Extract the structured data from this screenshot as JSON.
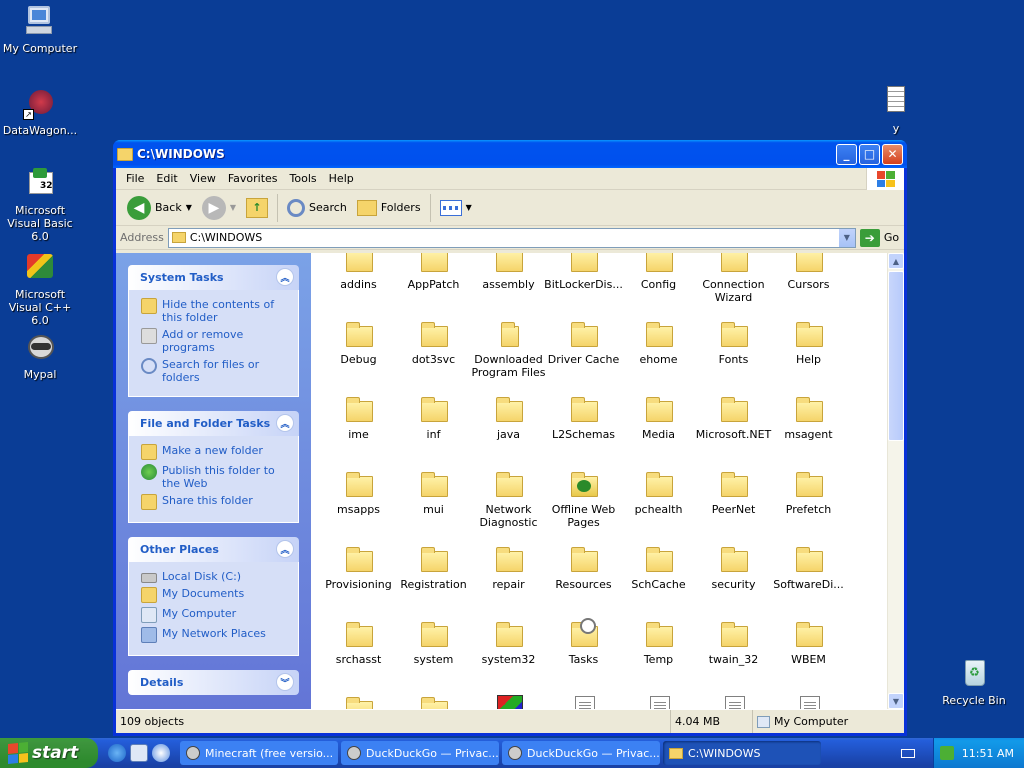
{
  "desktop": {
    "icons": [
      {
        "label": "My Computer"
      },
      {
        "label": "DataWagon..."
      },
      {
        "label": "Microsoft Visual Basic 6.0"
      },
      {
        "label": "Microsoft Visual C++ 6.0"
      },
      {
        "label": "Mypal"
      },
      {
        "label": "y"
      },
      {
        "label": "Recycle Bin"
      }
    ]
  },
  "window": {
    "title": "C:\\WINDOWS",
    "menu": [
      "File",
      "Edit",
      "View",
      "Favorites",
      "Tools",
      "Help"
    ],
    "toolbar": {
      "back": "Back",
      "search": "Search",
      "folders": "Folders"
    },
    "address": {
      "label": "Address",
      "value": "C:\\WINDOWS",
      "go": "Go"
    },
    "taskpane": {
      "system_tasks": {
        "title": "System Tasks",
        "links": [
          "Hide the contents of this folder",
          "Add or remove programs",
          "Search for files or folders"
        ]
      },
      "file_folder_tasks": {
        "title": "File and Folder Tasks",
        "links": [
          "Make a new folder",
          "Publish this folder to the Web",
          "Share this folder"
        ]
      },
      "other_places": {
        "title": "Other Places",
        "links": [
          "Local Disk (C:)",
          "My Documents",
          "My Computer",
          "My Network Places"
        ]
      },
      "details": {
        "title": "Details"
      }
    },
    "files": [
      {
        "name": "addins",
        "type": "folder"
      },
      {
        "name": "AppPatch",
        "type": "folder"
      },
      {
        "name": "assembly",
        "type": "folder"
      },
      {
        "name": "BitLockerDis...",
        "type": "folder"
      },
      {
        "name": "Config",
        "type": "folder"
      },
      {
        "name": "Connection Wizard",
        "type": "folder"
      },
      {
        "name": "Cursors",
        "type": "folder"
      },
      {
        "name": "Debug",
        "type": "folder"
      },
      {
        "name": "dot3svc",
        "type": "folder"
      },
      {
        "name": "Downloaded Program Files",
        "type": "folder-special"
      },
      {
        "name": "Driver Cache",
        "type": "folder"
      },
      {
        "name": "ehome",
        "type": "folder"
      },
      {
        "name": "Fonts",
        "type": "folder"
      },
      {
        "name": "Help",
        "type": "folder"
      },
      {
        "name": "ime",
        "type": "folder"
      },
      {
        "name": "inf",
        "type": "folder"
      },
      {
        "name": "java",
        "type": "folder"
      },
      {
        "name": "L2Schemas",
        "type": "folder"
      },
      {
        "name": "Media",
        "type": "folder"
      },
      {
        "name": "Microsoft.NET",
        "type": "folder"
      },
      {
        "name": "msagent",
        "type": "folder"
      },
      {
        "name": "msapps",
        "type": "folder"
      },
      {
        "name": "mui",
        "type": "folder"
      },
      {
        "name": "Network Diagnostic",
        "type": "folder"
      },
      {
        "name": "Offline Web Pages",
        "type": "folder-offline"
      },
      {
        "name": "pchealth",
        "type": "folder"
      },
      {
        "name": "PeerNet",
        "type": "folder"
      },
      {
        "name": "Prefetch",
        "type": "folder"
      },
      {
        "name": "Provisioning",
        "type": "folder"
      },
      {
        "name": "Registration",
        "type": "folder"
      },
      {
        "name": "repair",
        "type": "folder"
      },
      {
        "name": "Resources",
        "type": "folder"
      },
      {
        "name": "SchCache",
        "type": "folder"
      },
      {
        "name": "security",
        "type": "folder"
      },
      {
        "name": "SoftwareDi...",
        "type": "folder"
      },
      {
        "name": "srchasst",
        "type": "folder"
      },
      {
        "name": "system",
        "type": "folder"
      },
      {
        "name": "system32",
        "type": "folder"
      },
      {
        "name": "Tasks",
        "type": "folder-tasks"
      },
      {
        "name": "Temp",
        "type": "folder"
      },
      {
        "name": "twain_32",
        "type": "folder"
      },
      {
        "name": "WBEM",
        "type": "folder"
      },
      {
        "name": "",
        "type": "folder"
      },
      {
        "name": "",
        "type": "folder"
      },
      {
        "name": "",
        "type": "ms-file"
      },
      {
        "name": "",
        "type": "document"
      },
      {
        "name": "",
        "type": "document"
      },
      {
        "name": "",
        "type": "window-file"
      },
      {
        "name": "",
        "type": "document"
      }
    ],
    "status": {
      "objects": "109 objects",
      "size": "4.04 MB",
      "location": "My Computer"
    }
  },
  "taskbar": {
    "start": "start",
    "tasks": [
      {
        "label": "Minecraft (free versio...",
        "active": false
      },
      {
        "label": "DuckDuckGo — Privac...",
        "active": false
      },
      {
        "label": "DuckDuckGo — Privac...",
        "active": false
      },
      {
        "label": "C:\\WINDOWS",
        "active": true
      }
    ],
    "clock": "11:51 AM"
  },
  "colors": {
    "desktop": "#0a3d96",
    "titlebar": "#0053ee",
    "taskpane": "#6375d6",
    "link": "#215dc6",
    "start": "#3d943d"
  }
}
